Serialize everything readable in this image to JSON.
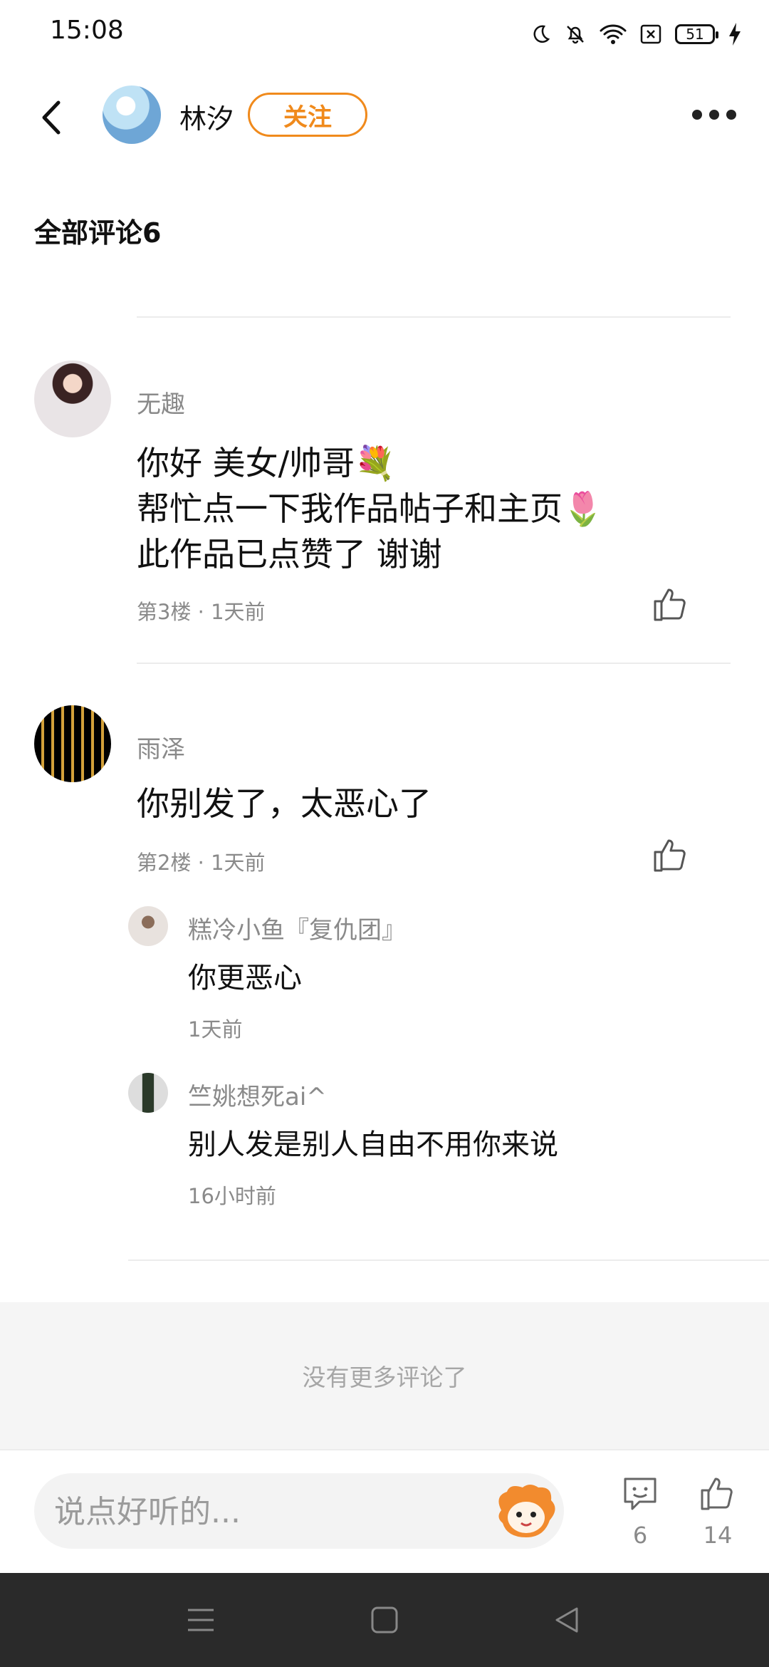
{
  "status_bar": {
    "time": "15:08",
    "battery": "51"
  },
  "header": {
    "author_name": "林汐",
    "follow_label": "关注"
  },
  "section": {
    "title": "全部评论6"
  },
  "comments": [
    {
      "username": "无趣",
      "lines": [
        "你好 美女/帅哥💐",
        "帮忙点一下我作品帖子和主页🌷",
        "此作品已点赞了 谢谢"
      ],
      "floor": "第3楼",
      "time": "1天前"
    },
    {
      "username": "雨泽",
      "text": "你别发了，太恶心了",
      "floor": "第2楼",
      "time": "1天前",
      "replies": [
        {
          "username": "糕冷小鱼『复仇团』",
          "text": "你更恶心",
          "time": "1天前"
        },
        {
          "username": "竺姚想死ai^",
          "text": "别人发是别人自由不用你来说",
          "time": "16小时前"
        }
      ]
    }
  ],
  "footer": {
    "no_more": "没有更多评论了"
  },
  "bottom_bar": {
    "input_placeholder": "说点好听的...",
    "comment_count": "6",
    "like_count": "14"
  },
  "colors": {
    "accent": "#f08a1c",
    "text": "#111111",
    "muted": "#8a8a8a"
  }
}
